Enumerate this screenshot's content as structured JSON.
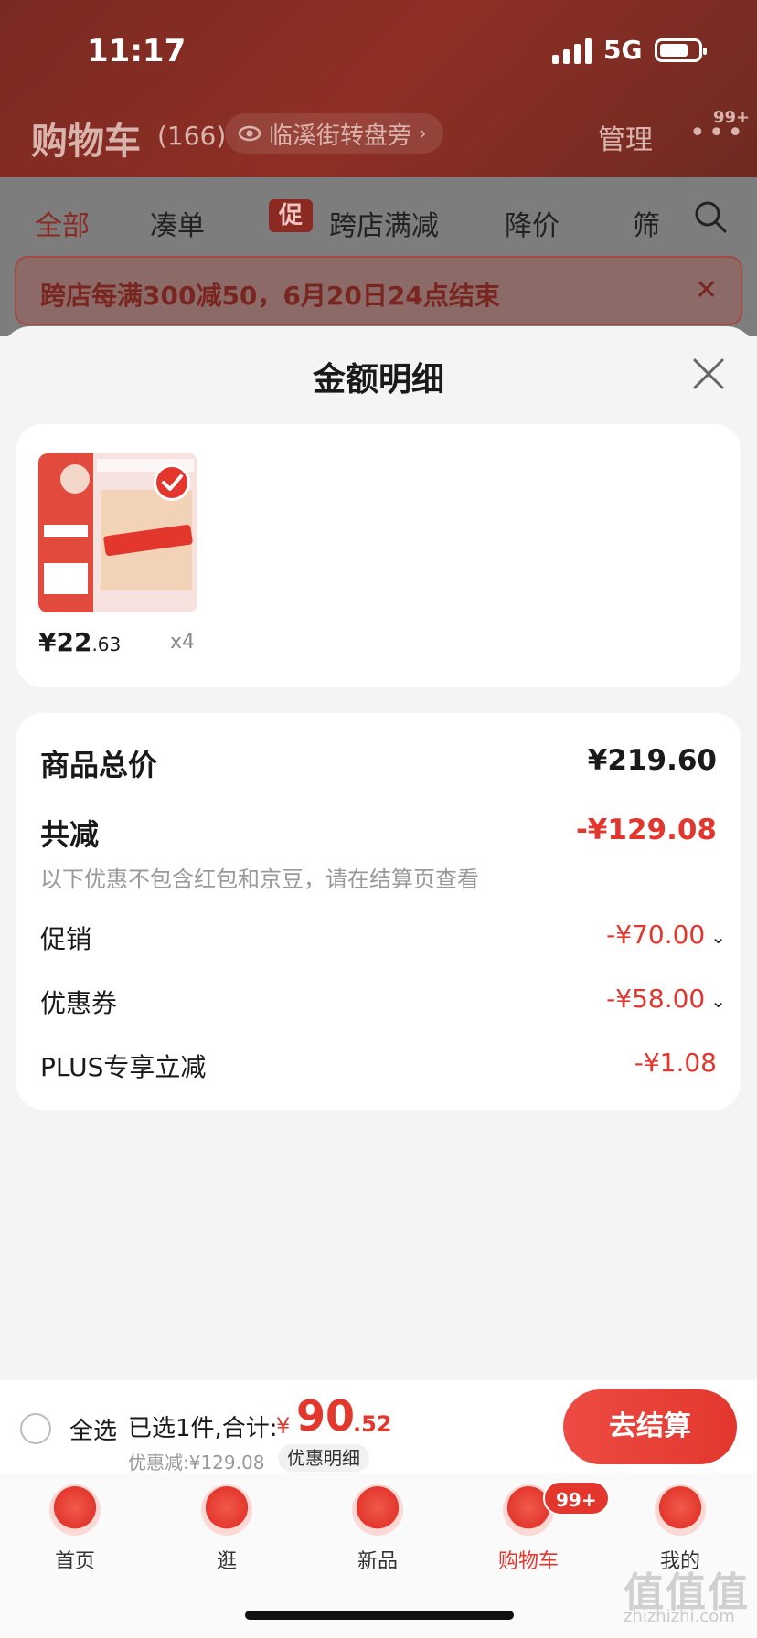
{
  "status_bar": {
    "time": "11:17",
    "network": "5G"
  },
  "background": {
    "header": {
      "title": "购物车",
      "count": "(166)",
      "location": "临溪街转盘旁",
      "manage": "管理",
      "more_badge": "99+"
    },
    "tabs": [
      {
        "label": "全部"
      },
      {
        "label": "凑单"
      },
      {
        "label": "跨店满减",
        "tag": "促"
      },
      {
        "label": "降价"
      },
      {
        "label": "筛"
      }
    ],
    "banner": {
      "text": "跨店每满300减50，6月20日24点结束"
    }
  },
  "sheet": {
    "title": "金额明细",
    "product": {
      "price_int": "¥22",
      "price_cents": ".63",
      "quantity": "x4"
    },
    "summary": {
      "total_label": "商品总价",
      "total_value": "¥219.60",
      "reduce_label": "共减",
      "reduce_value": "-¥129.08",
      "note": "以下优惠不包含红包和京豆，请在结算页查看",
      "items": [
        {
          "label": "促销",
          "value": "-¥70.00"
        },
        {
          "label": "优惠券",
          "value": "-¥58.00"
        },
        {
          "label": "PLUS专享立减",
          "value": "-¥1.08"
        }
      ]
    }
  },
  "bottom_bar": {
    "select_all": "全选",
    "selected_text": "已选1件,合计:",
    "currency": "¥",
    "total_int": "90",
    "total_cents": ".52",
    "discount_text": "优惠减:¥129.08",
    "detail_button": "优惠明细",
    "checkout": "去结算"
  },
  "nav": {
    "items": [
      {
        "label": "首页"
      },
      {
        "label": "逛"
      },
      {
        "label": "新品"
      },
      {
        "label": "购物车"
      },
      {
        "label": "我的"
      }
    ],
    "cart_badge": "99+"
  },
  "watermark": {
    "main": "值值值",
    "sub": "zhizhizhi.com"
  },
  "colors": {
    "accent": "#e3372e",
    "header_bg": "#7a2a22",
    "overlay": "#7d7d7d"
  }
}
